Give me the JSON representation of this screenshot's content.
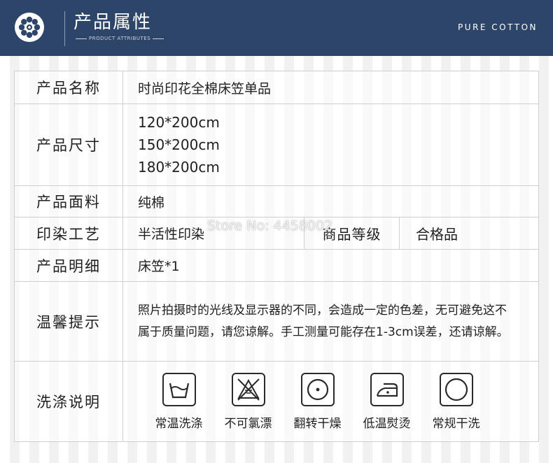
{
  "header": {
    "title": "产品属性",
    "subtitle": "PRODUCT ATTRIBUTES",
    "brand": "PURE COTTON",
    "logo_icon": "flower-logo-icon",
    "background_color": "#2d4568"
  },
  "table": {
    "rows": [
      {
        "label": "产品名称",
        "value": "时尚印花全棉床笠单品"
      },
      {
        "label": "产品尺寸",
        "values": [
          "120*200cm",
          "150*200cm",
          "180*200cm"
        ]
      },
      {
        "label": "产品面料",
        "value": "纯棉"
      },
      {
        "label": "印染工艺",
        "value": "半活性印染",
        "sub_label": "商品等级",
        "sub_value": "合格品"
      },
      {
        "label": "产品明细",
        "value": "床笠*1"
      },
      {
        "label": "温馨提示",
        "value": "照片拍摄时的光线及显示器的不同，会造成一定的色差，无可避免这不属于质量问题，请您谅解。手工测量可能存在1-3cm误差，还请谅解。"
      },
      {
        "label": "洗涤说明"
      }
    ],
    "care": [
      {
        "icon": "washtub-icon",
        "label": "常温洗涤"
      },
      {
        "icon": "no-bleach-icon",
        "label": "不可氯漂"
      },
      {
        "icon": "tumble-dry-icon",
        "label": "翻转干燥"
      },
      {
        "icon": "iron-low-icon",
        "label": "低温熨烫"
      },
      {
        "icon": "dry-clean-icon",
        "label": "常规干洗"
      }
    ]
  },
  "watermark": "Store No: 4458002"
}
